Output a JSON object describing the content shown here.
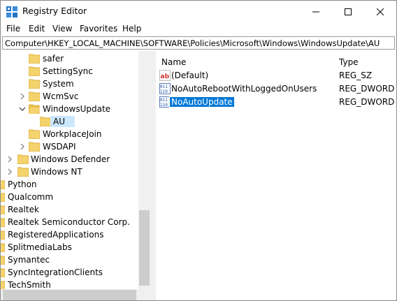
{
  "window": {
    "title": "Registry Editor"
  },
  "menu": [
    "File",
    "Edit",
    "View",
    "Favorites",
    "Help"
  ],
  "address": "Computer\\HKEY_LOCAL_MACHINE\\SOFTWARE\\Policies\\Microsoft\\Windows\\WindowsUpdate\\AU",
  "tree": [
    {
      "label": "safer"
    },
    {
      "label": "SettingSync"
    },
    {
      "label": "System"
    },
    {
      "label": "WcmSvc"
    },
    {
      "label": "WindowsUpdate"
    },
    {
      "label": "AU"
    },
    {
      "label": "WorkplaceJoin"
    },
    {
      "label": "WSDAPI"
    },
    {
      "label": "Windows Defender"
    },
    {
      "label": "Windows NT"
    },
    {
      "label": "Python"
    },
    {
      "label": "Qualcomm"
    },
    {
      "label": "Realtek"
    },
    {
      "label": "Realtek Semiconductor Corp."
    },
    {
      "label": "RegisteredApplications"
    },
    {
      "label": "SplitmediaLabs"
    },
    {
      "label": "Symantec"
    },
    {
      "label": "SyncIntegrationClients"
    },
    {
      "label": "TechSmith"
    }
  ],
  "columns": {
    "name": "Name",
    "type": "Type"
  },
  "values": [
    {
      "name": "(Default)",
      "type": "REG_SZ",
      "icon": "string-value-icon"
    },
    {
      "name": "NoAutoRebootWithLoggedOnUsers",
      "type": "REG_DWORD",
      "icon": "dword-value-icon"
    },
    {
      "name": "NoAutoUpdate",
      "type": "REG_DWORD",
      "icon": "dword-value-icon"
    }
  ],
  "colors": {
    "selection": "#0078d7",
    "tree_selection": "#cce8ff",
    "folder": "#f5d36c"
  }
}
